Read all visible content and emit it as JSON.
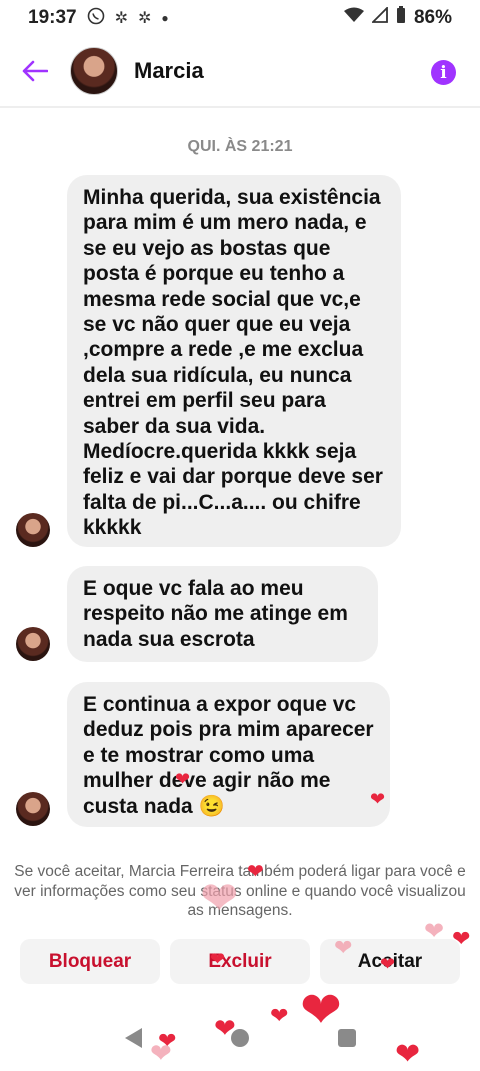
{
  "status_bar": {
    "time": "19:37",
    "notification_icons": [
      "whatsapp-icon",
      "app-icon",
      "app-icon",
      "dot-icon"
    ],
    "battery": "86%"
  },
  "header": {
    "contact_name": "Marcia"
  },
  "conversation": {
    "timestamp": "QUI. ÀS 21:21",
    "messages": [
      {
        "text": "Minha querida, sua existência para mim é um mero nada, e se eu vejo as bostas que posta é porque eu tenho a mesma rede social que vc,e se vc não quer que eu veja ,compre a rede ,e me exclua dela sua ridícula, eu nunca entrei em perfil seu para saber da sua vida. Medíocre.querida kkkk seja feliz e vai dar porque deve ser falta de pi...C...a.... ou chifre kkkkk"
      },
      {
        "text": "E oque vc fala ao meu respeito não me atinge em nada sua escrota"
      },
      {
        "text": "E continua a expor oque vc deduz pois pra mim aparecer e te mostrar como uma mulher deve agir não me custa nada 😉"
      }
    ]
  },
  "request_notice": "Se você aceitar, Marcia Ferreira também poderá ligar para você e ver informações como seu status online e quando você visualizou as mensagens.",
  "actions": {
    "block": "Bloquear",
    "delete": "Excluir",
    "accept": "Aceitar"
  },
  "colors": {
    "accent": "#a033ff",
    "danger": "#c8102e",
    "bubble": "#efefef",
    "heart": "#e8263f"
  }
}
